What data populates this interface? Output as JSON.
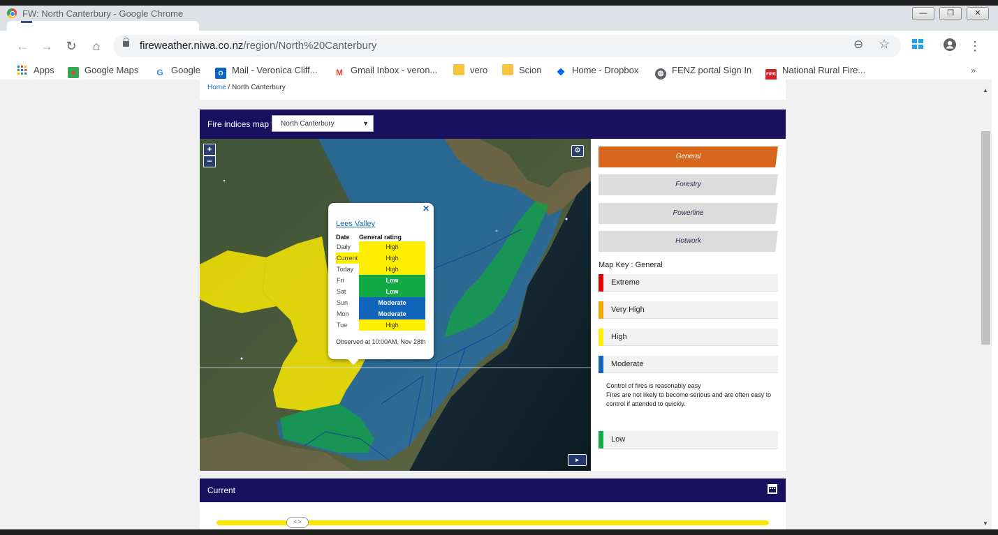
{
  "window": {
    "title": "FW: North Canterbury - Google Chrome",
    "controls": {
      "minimize": "—",
      "restore": "❐",
      "close": "✕"
    }
  },
  "toolbar": {
    "url_host": "fireweather.niwa.co.nz",
    "url_path": "/region/North%20Canterbury"
  },
  "bookmarks": [
    {
      "label": "Apps",
      "icon": "apps-grid-icon"
    },
    {
      "label": "Google Maps",
      "icon": "google-maps-icon"
    },
    {
      "label": "Google",
      "icon": "google-icon"
    },
    {
      "label": "Mail - Veronica Cliff...",
      "icon": "outlook-icon"
    },
    {
      "label": "Gmail Inbox - veron...",
      "icon": "gmail-icon"
    },
    {
      "label": "vero",
      "icon": "folder-icon"
    },
    {
      "label": "Scion",
      "icon": "folder-icon"
    },
    {
      "label": "Home - Dropbox",
      "icon": "dropbox-icon"
    },
    {
      "label": "FENZ portal Sign In",
      "icon": "globe-icon"
    },
    {
      "label": "National Rural Fire...",
      "icon": "fire-service-icon"
    }
  ],
  "breadcrumb": {
    "home": "Home",
    "separator": "/",
    "current": "North Canterbury"
  },
  "map_panel": {
    "title": "Fire indices map for",
    "region_selected": "North Canterbury"
  },
  "popup": {
    "place": "Lees Valley",
    "col_date": "Date",
    "col_rating": "General rating",
    "rows": [
      {
        "date": "Daily",
        "rating": "High",
        "level": "high"
      },
      {
        "date": "Current",
        "rating": "High",
        "level": "high"
      },
      {
        "date": "Today",
        "rating": "High",
        "level": "high"
      },
      {
        "date": "Fri",
        "rating": "Low",
        "level": "low"
      },
      {
        "date": "Sat",
        "rating": "Low",
        "level": "low"
      },
      {
        "date": "Sun",
        "rating": "Moderate",
        "level": "moderate"
      },
      {
        "date": "Mon",
        "rating": "Moderate",
        "level": "moderate"
      },
      {
        "date": "Tue",
        "rating": "High",
        "level": "high"
      }
    ],
    "observed": "Observed at 10:00AM, Nov 28th"
  },
  "index_tabs": [
    {
      "label": "General",
      "active": true
    },
    {
      "label": "Forestry",
      "active": false
    },
    {
      "label": "Powerline",
      "active": false
    },
    {
      "label": "Hotwork",
      "active": false
    }
  ],
  "map_key": {
    "title": "Map Key : General",
    "levels": [
      {
        "label": "Extreme",
        "color": "#e00000"
      },
      {
        "label": "Very High",
        "color": "#f5a500"
      },
      {
        "label": "High",
        "color": "#ffee00"
      },
      {
        "label": "Moderate",
        "color": "#1166bb"
      },
      {
        "label": "Low",
        "color": "#11aa44"
      }
    ],
    "description_line1": "Control of fires is reasonably easy",
    "description_line2": "Fires are not likely to become serious and are often easy to control if attended to quickly."
  },
  "current_panel": {
    "title": "Current",
    "handle_label": "< >"
  },
  "colors": {
    "navy": "#1a1060",
    "accent_orange": "#d8661d",
    "high": "#ffee00",
    "low": "#11aa44",
    "moderate": "#1166bb"
  }
}
